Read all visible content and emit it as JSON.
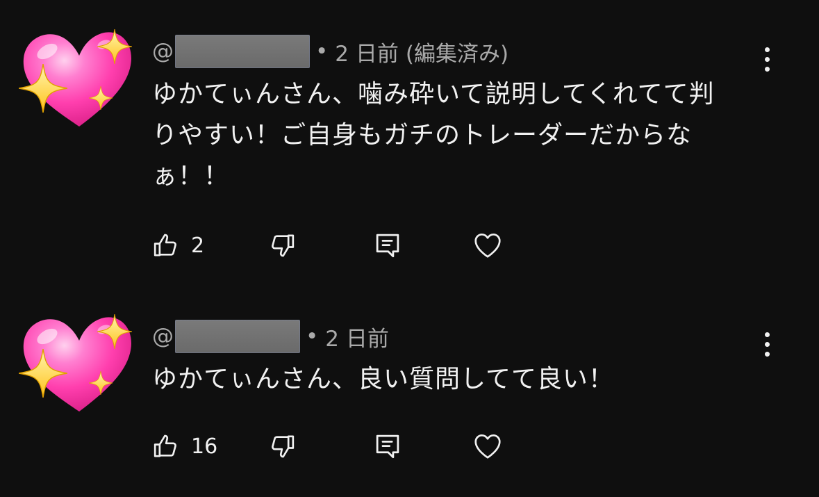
{
  "comments": [
    {
      "handle_prefix": "@",
      "separator": "•",
      "time": "2 日前",
      "edited": "(編集済み)",
      "text": "ゆかてぃんさん、噛み砕いて説明してくれてて判\nりやすい！ご自身もガチのトレーダーだからな\nぁ！！",
      "like_count": "2",
      "avatar_icon": "sparkling-heart-emoji"
    },
    {
      "handle_prefix": "@",
      "separator": "•",
      "time": "2 日前",
      "edited": "",
      "text": "ゆかてぃんさん、良い質問してて良い！",
      "like_count": "16",
      "avatar_icon": "sparkling-heart-emoji"
    }
  ],
  "icons": {
    "like": "thumbs-up-icon",
    "dislike": "thumbs-down-icon",
    "reply": "reply-comment-icon",
    "heart": "heart-outline-icon",
    "menu": "more-vertical-icon"
  },
  "colors": {
    "background": "#0f0f0f",
    "text_primary": "#f1f1f1",
    "text_secondary": "#aaaaaa",
    "heart_pink": "#ff4fb4",
    "sparkle_yellow": "#ffd93b"
  }
}
